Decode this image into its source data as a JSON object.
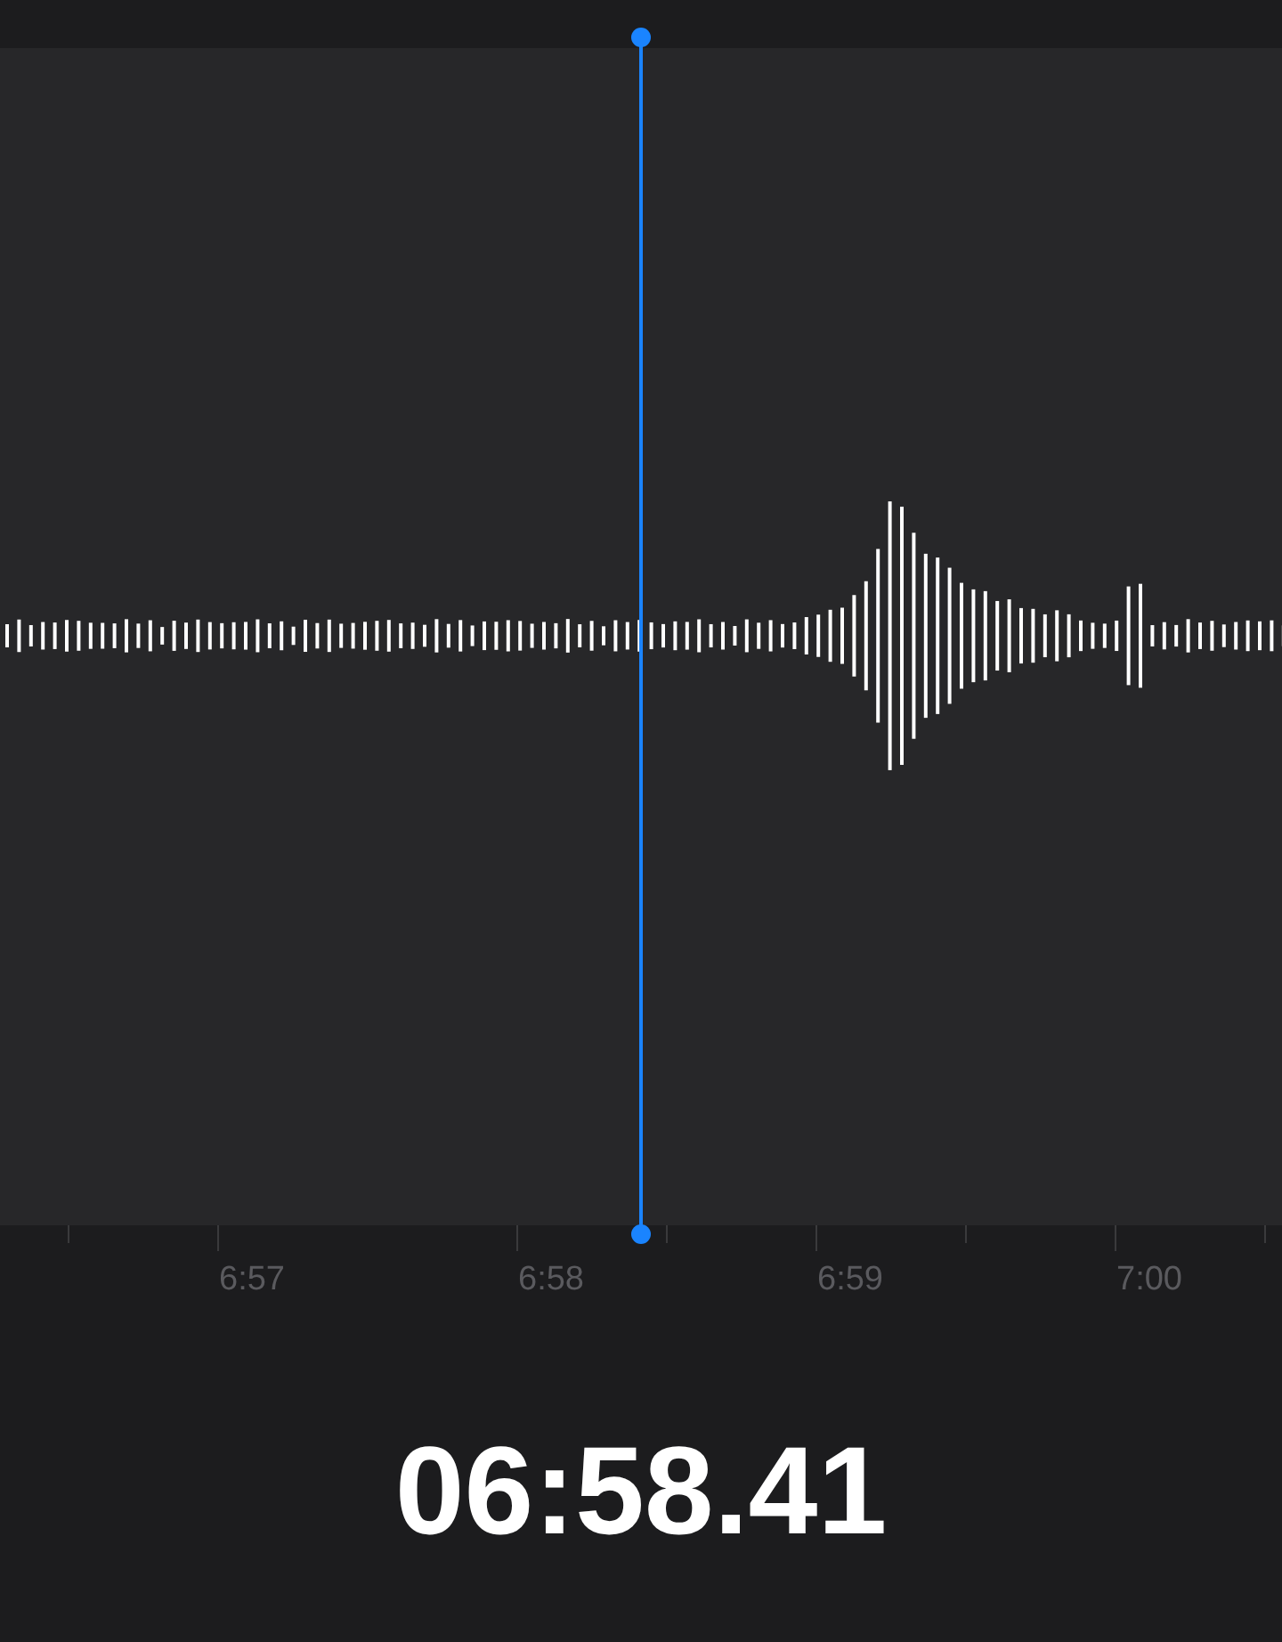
{
  "timeline": {
    "labels": [
      "6:57",
      "6:58",
      "6:59",
      "7:00"
    ]
  },
  "elapsed_time": "06:58.41"
}
